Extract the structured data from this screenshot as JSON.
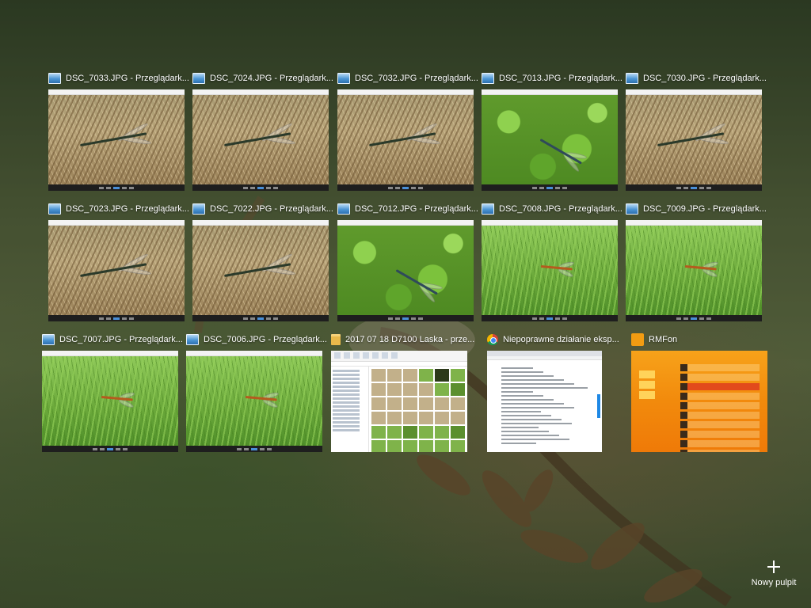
{
  "windows": [
    {
      "title": "DSC_7033.JPG - Przeglądark...",
      "icon": "photos-app-icon",
      "scene": "dry"
    },
    {
      "title": "DSC_7024.JPG - Przeglądark...",
      "icon": "photos-app-icon",
      "scene": "dry"
    },
    {
      "title": "DSC_7032.JPG - Przeglądark...",
      "icon": "photos-app-icon",
      "scene": "dry"
    },
    {
      "title": "DSC_7013.JPG - Przeglądark...",
      "icon": "photos-app-icon",
      "scene": "leaf"
    },
    {
      "title": "DSC_7030.JPG - Przeglądark...",
      "icon": "photos-app-icon",
      "scene": "dry"
    },
    {
      "title": "DSC_7023.JPG - Przeglądark...",
      "icon": "photos-app-icon",
      "scene": "dry"
    },
    {
      "title": "DSC_7022.JPG - Przeglądark...",
      "icon": "photos-app-icon",
      "scene": "dry"
    },
    {
      "title": "DSC_7012.JPG - Przeglądark...",
      "icon": "photos-app-icon",
      "scene": "leaf"
    },
    {
      "title": "DSC_7008.JPG - Przeglądark...",
      "icon": "photos-app-icon",
      "scene": "grass"
    },
    {
      "title": "DSC_7009.JPG - Przeglądark...",
      "icon": "photos-app-icon",
      "scene": "grass"
    },
    {
      "title": "DSC_7007.JPG - Przeglądark...",
      "icon": "photos-app-icon",
      "scene": "grass"
    },
    {
      "title": "DSC_7006.JPG - Przeglądark...",
      "icon": "photos-app-icon",
      "scene": "grass"
    },
    {
      "title": "2017 07 18 D7100 Laska - prze...",
      "icon": "folder-icon",
      "scene": "explorer"
    },
    {
      "title": "Niepoprawne działanie eksp...",
      "icon": "chrome-icon",
      "scene": "browser"
    },
    {
      "title": "RMFon",
      "icon": "rmfon-icon",
      "scene": "rmf"
    }
  ],
  "new_desktop": {
    "label": "Nowy pulpit",
    "icon": "plus-icon"
  }
}
